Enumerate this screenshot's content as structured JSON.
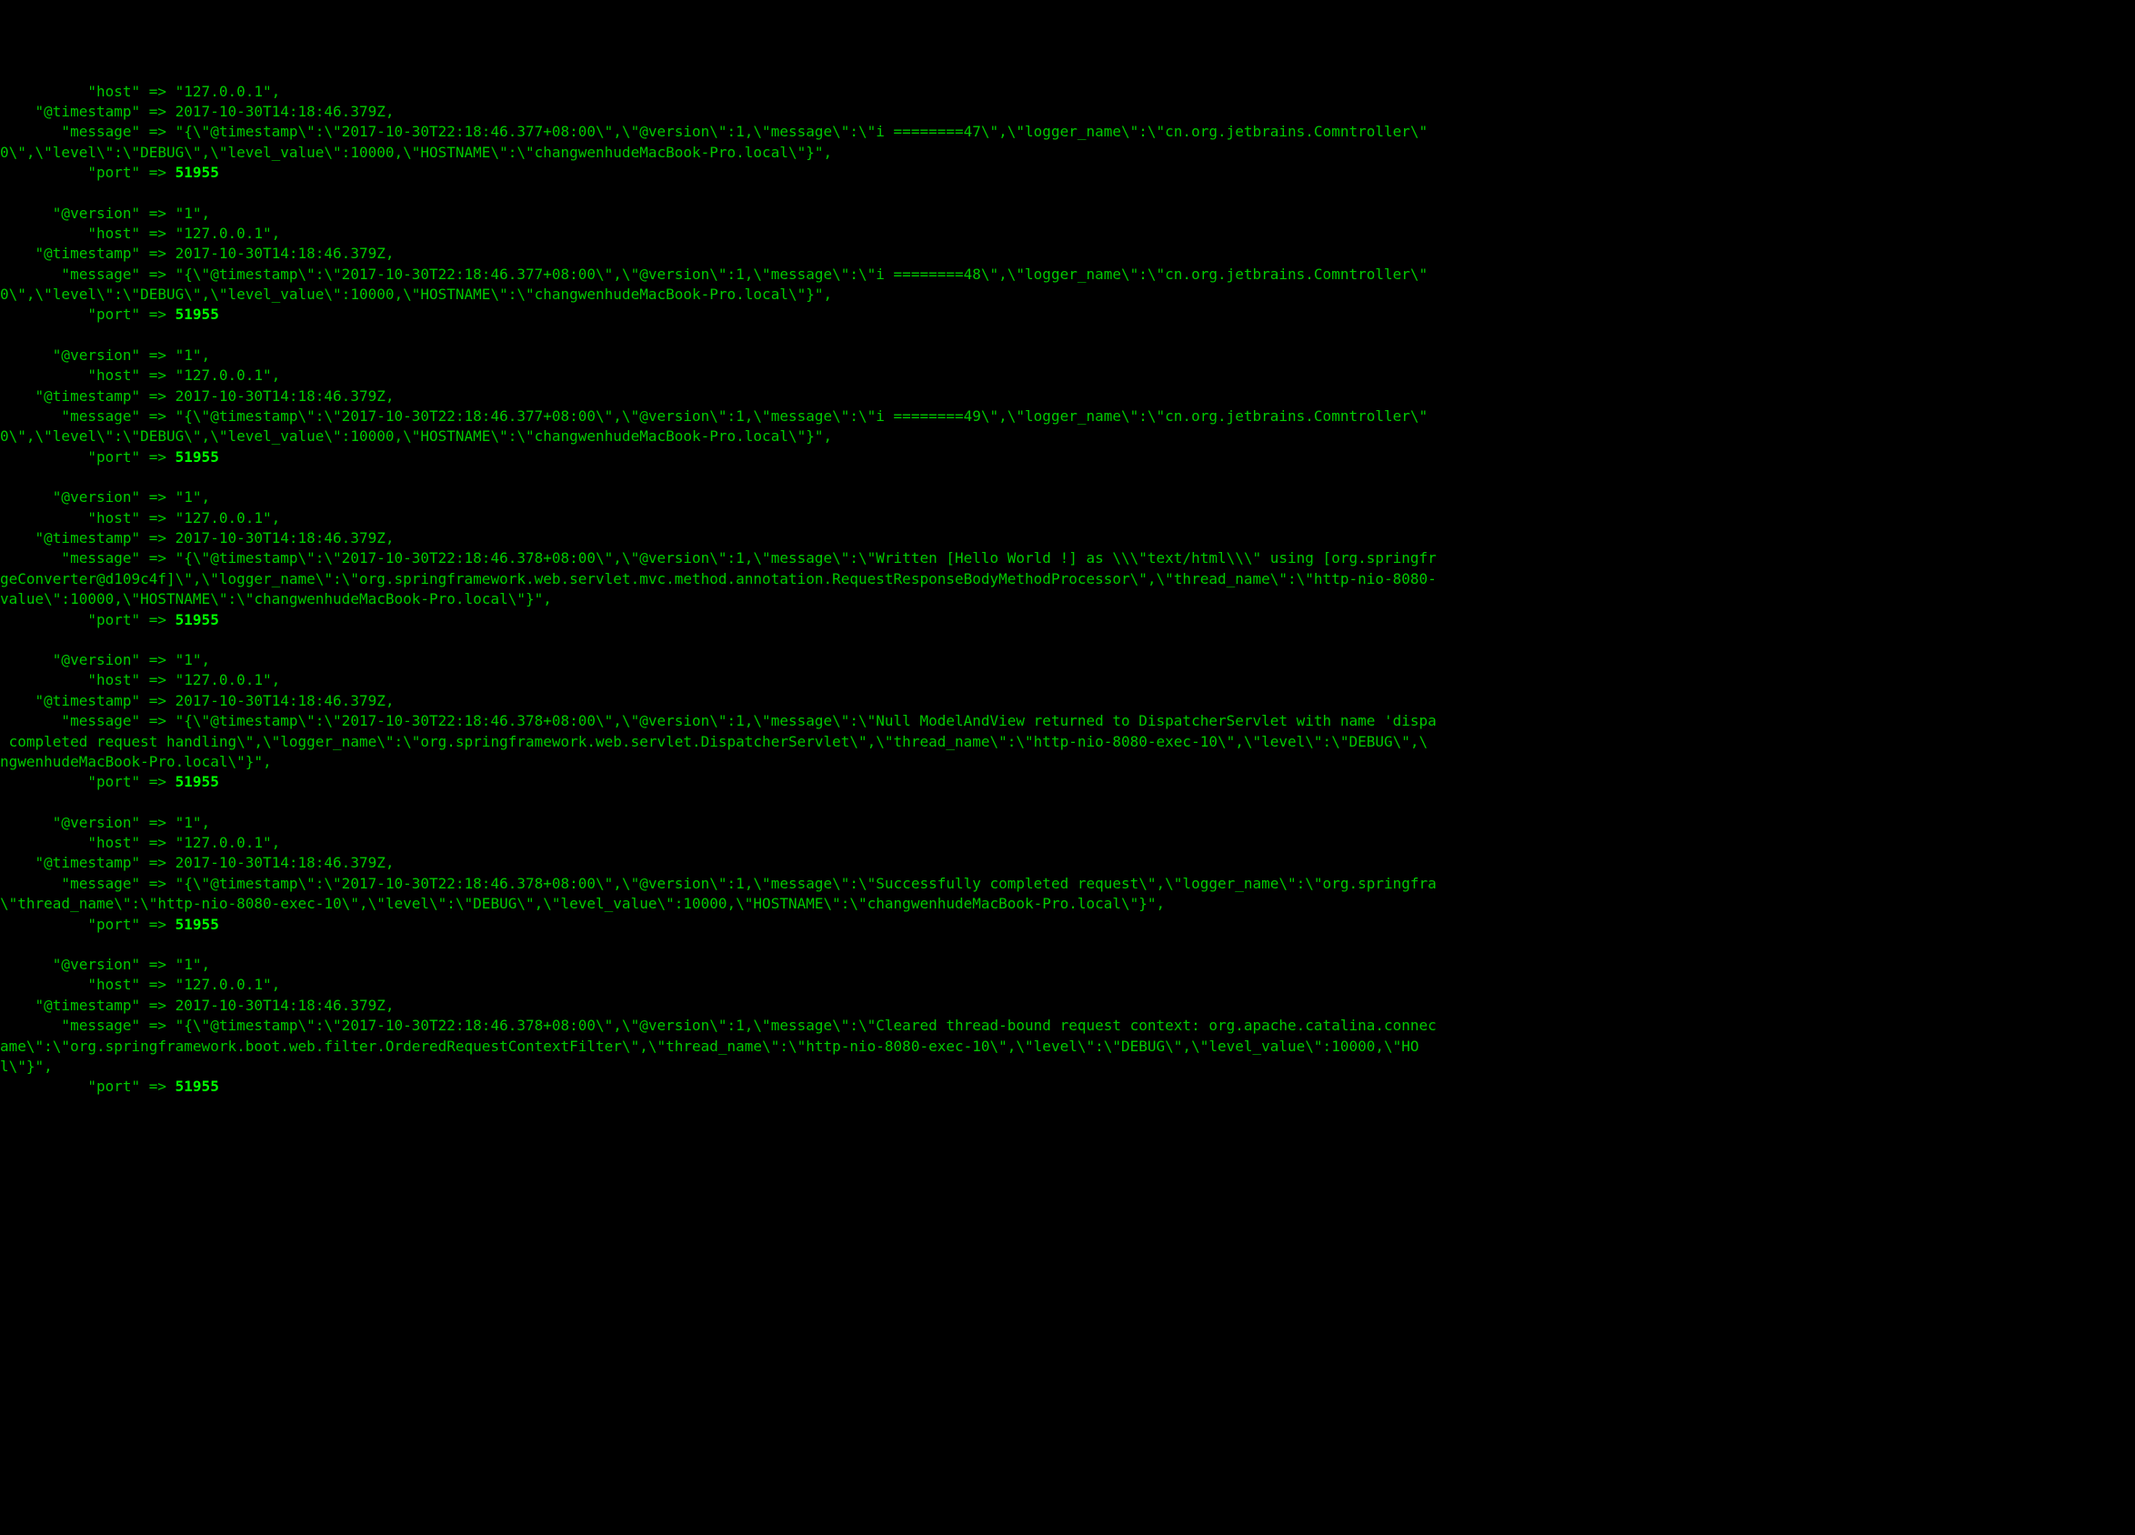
{
  "entries": [
    {
      "lines": [
        {
          "key": "\"host\"",
          "val": "\"127.0.0.1\"",
          "trailingComma": true,
          "keyPad": 10,
          "bold": false
        },
        {
          "key": "\"@timestamp\"",
          "val": "2017-10-30T14:18:46.379Z",
          "trailingComma": true,
          "keyPad": 4,
          "bold": false
        }
      ],
      "messageKey": "\"message\"",
      "messageKeyPad": 7,
      "messageLines": [
        "\"{\\\"@timestamp\\\":\\\"2017-10-30T22:18:46.377+08:00\\\",\\\"@version\\\":1,\\\"message\\\":\\\"i ========47\\\",\\\"logger_name\\\":\\\"cn.org.jetbrains.Comntroller\\\"",
        "0\\\",\\\"level\\\":\\\"DEBUG\\\",\\\"level_value\\\":10000,\\\"HOSTNAME\\\":\\\"changwenhudeMacBook-Pro.local\\\"}\","
      ],
      "port": {
        "key": "\"port\"",
        "val": "51955",
        "keyPad": 10,
        "bold": true
      }
    },
    {
      "lines": [
        {
          "key": "\"@version\"",
          "val": "\"1\"",
          "trailingComma": true,
          "keyPad": 6,
          "bold": false
        },
        {
          "key": "\"host\"",
          "val": "\"127.0.0.1\"",
          "trailingComma": true,
          "keyPad": 10,
          "bold": false
        },
        {
          "key": "\"@timestamp\"",
          "val": "2017-10-30T14:18:46.379Z",
          "trailingComma": true,
          "keyPad": 4,
          "bold": false
        }
      ],
      "messageKey": "\"message\"",
      "messageKeyPad": 7,
      "messageLines": [
        "\"{\\\"@timestamp\\\":\\\"2017-10-30T22:18:46.377+08:00\\\",\\\"@version\\\":1,\\\"message\\\":\\\"i ========48\\\",\\\"logger_name\\\":\\\"cn.org.jetbrains.Comntroller\\\"",
        "0\\\",\\\"level\\\":\\\"DEBUG\\\",\\\"level_value\\\":10000,\\\"HOSTNAME\\\":\\\"changwenhudeMacBook-Pro.local\\\"}\","
      ],
      "port": {
        "key": "\"port\"",
        "val": "51955",
        "keyPad": 10,
        "bold": true
      }
    },
    {
      "lines": [
        {
          "key": "\"@version\"",
          "val": "\"1\"",
          "trailingComma": true,
          "keyPad": 6,
          "bold": false
        },
        {
          "key": "\"host\"",
          "val": "\"127.0.0.1\"",
          "trailingComma": true,
          "keyPad": 10,
          "bold": false
        },
        {
          "key": "\"@timestamp\"",
          "val": "2017-10-30T14:18:46.379Z",
          "trailingComma": true,
          "keyPad": 4,
          "bold": false
        }
      ],
      "messageKey": "\"message\"",
      "messageKeyPad": 7,
      "messageLines": [
        "\"{\\\"@timestamp\\\":\\\"2017-10-30T22:18:46.377+08:00\\\",\\\"@version\\\":1,\\\"message\\\":\\\"i ========49\\\",\\\"logger_name\\\":\\\"cn.org.jetbrains.Comntroller\\\"",
        "0\\\",\\\"level\\\":\\\"DEBUG\\\",\\\"level_value\\\":10000,\\\"HOSTNAME\\\":\\\"changwenhudeMacBook-Pro.local\\\"}\","
      ],
      "port": {
        "key": "\"port\"",
        "val": "51955",
        "keyPad": 10,
        "bold": true
      }
    },
    {
      "lines": [
        {
          "key": "\"@version\"",
          "val": "\"1\"",
          "trailingComma": true,
          "keyPad": 6,
          "bold": false
        },
        {
          "key": "\"host\"",
          "val": "\"127.0.0.1\"",
          "trailingComma": true,
          "keyPad": 10,
          "bold": false
        },
        {
          "key": "\"@timestamp\"",
          "val": "2017-10-30T14:18:46.379Z",
          "trailingComma": true,
          "keyPad": 4,
          "bold": false
        }
      ],
      "messageKey": "\"message\"",
      "messageKeyPad": 7,
      "messageLines": [
        "\"{\\\"@timestamp\\\":\\\"2017-10-30T22:18:46.378+08:00\\\",\\\"@version\\\":1,\\\"message\\\":\\\"Written [Hello World !] as \\\\\\\"text/html\\\\\\\" using [org.springfr",
        "geConverter@d109c4f]\\\",\\\"logger_name\\\":\\\"org.springframework.web.servlet.mvc.method.annotation.RequestResponseBodyMethodProcessor\\\",\\\"thread_name\\\":\\\"http-nio-8080-",
        "value\\\":10000,\\\"HOSTNAME\\\":\\\"changwenhudeMacBook-Pro.local\\\"}\","
      ],
      "port": {
        "key": "\"port\"",
        "val": "51955",
        "keyPad": 10,
        "bold": true
      }
    },
    {
      "lines": [
        {
          "key": "\"@version\"",
          "val": "\"1\"",
          "trailingComma": true,
          "keyPad": 6,
          "bold": false
        },
        {
          "key": "\"host\"",
          "val": "\"127.0.0.1\"",
          "trailingComma": true,
          "keyPad": 10,
          "bold": false
        },
        {
          "key": "\"@timestamp\"",
          "val": "2017-10-30T14:18:46.379Z",
          "trailingComma": true,
          "keyPad": 4,
          "bold": false
        }
      ],
      "messageKey": "\"message\"",
      "messageKeyPad": 7,
      "messageLines": [
        "\"{\\\"@timestamp\\\":\\\"2017-10-30T22:18:46.378+08:00\\\",\\\"@version\\\":1,\\\"message\\\":\\\"Null ModelAndView returned to DispatcherServlet with name 'dispa",
        " completed request handling\\\",\\\"logger_name\\\":\\\"org.springframework.web.servlet.DispatcherServlet\\\",\\\"thread_name\\\":\\\"http-nio-8080-exec-10\\\",\\\"level\\\":\\\"DEBUG\\\",\\",
        "ngwenhudeMacBook-Pro.local\\\"}\","
      ],
      "port": {
        "key": "\"port\"",
        "val": "51955",
        "keyPad": 10,
        "bold": true
      }
    },
    {
      "lines": [
        {
          "key": "\"@version\"",
          "val": "\"1\"",
          "trailingComma": true,
          "keyPad": 6,
          "bold": false
        },
        {
          "key": "\"host\"",
          "val": "\"127.0.0.1\"",
          "trailingComma": true,
          "keyPad": 10,
          "bold": false
        },
        {
          "key": "\"@timestamp\"",
          "val": "2017-10-30T14:18:46.379Z",
          "trailingComma": true,
          "keyPad": 4,
          "bold": false
        }
      ],
      "messageKey": "\"message\"",
      "messageKeyPad": 7,
      "messageLines": [
        "\"{\\\"@timestamp\\\":\\\"2017-10-30T22:18:46.378+08:00\\\",\\\"@version\\\":1,\\\"message\\\":\\\"Successfully completed request\\\",\\\"logger_name\\\":\\\"org.springfra",
        "\\\"thread_name\\\":\\\"http-nio-8080-exec-10\\\",\\\"level\\\":\\\"DEBUG\\\",\\\"level_value\\\":10000,\\\"HOSTNAME\\\":\\\"changwenhudeMacBook-Pro.local\\\"}\","
      ],
      "port": {
        "key": "\"port\"",
        "val": "51955",
        "keyPad": 10,
        "bold": true
      }
    },
    {
      "lines": [
        {
          "key": "\"@version\"",
          "val": "\"1\"",
          "trailingComma": true,
          "keyPad": 6,
          "bold": false
        },
        {
          "key": "\"host\"",
          "val": "\"127.0.0.1\"",
          "trailingComma": true,
          "keyPad": 10,
          "bold": false
        },
        {
          "key": "\"@timestamp\"",
          "val": "2017-10-30T14:18:46.379Z",
          "trailingComma": true,
          "keyPad": 4,
          "bold": false
        }
      ],
      "messageKey": "\"message\"",
      "messageKeyPad": 7,
      "messageLines": [
        "\"{\\\"@timestamp\\\":\\\"2017-10-30T22:18:46.378+08:00\\\",\\\"@version\\\":1,\\\"message\\\":\\\"Cleared thread-bound request context: org.apache.catalina.connec",
        "ame\\\":\\\"org.springframework.boot.web.filter.OrderedRequestContextFilter\\\",\\\"thread_name\\\":\\\"http-nio-8080-exec-10\\\",\\\"level\\\":\\\"DEBUG\\\",\\\"level_value\\\":10000,\\\"HO",
        "l\\\"}\","
      ],
      "port": {
        "key": "\"port\"",
        "val": "51955",
        "keyPad": 10,
        "bold": true
      }
    }
  ],
  "arrow": " => "
}
